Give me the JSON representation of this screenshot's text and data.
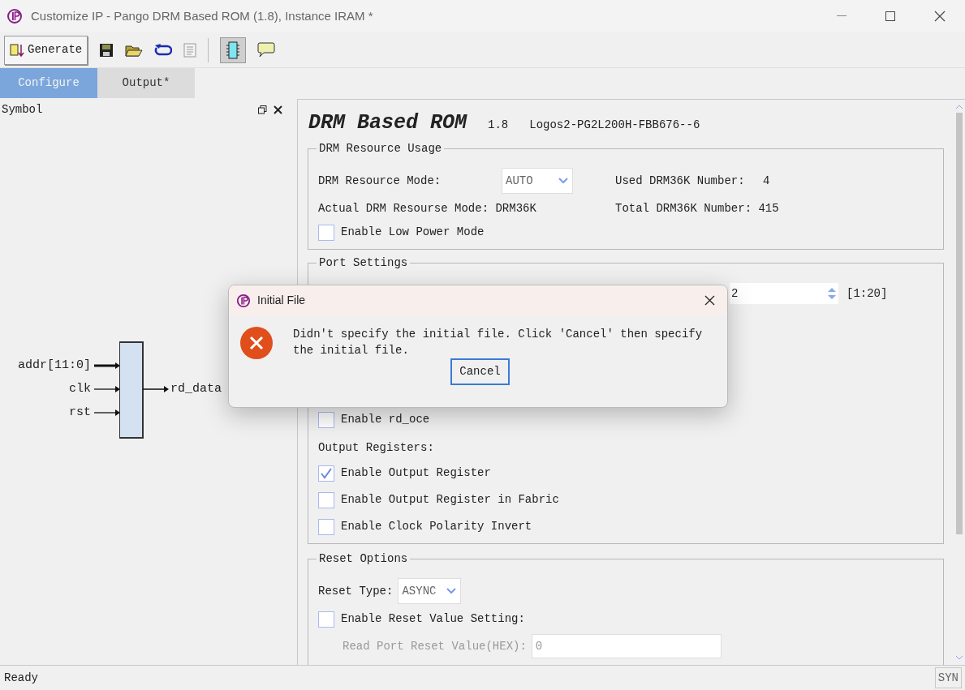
{
  "window": {
    "title": "Customize IP - Pango DRM Based ROM (1.8), Instance IRAM *"
  },
  "toolbar": {
    "generate_label": "Generate"
  },
  "tabs": [
    {
      "label": "Configure",
      "selected": true
    },
    {
      "label": "Output*",
      "selected": false
    }
  ],
  "symbol_panel": {
    "title": "Symbol",
    "inputs": [
      {
        "label": "addr[11:0]",
        "bus": true
      },
      {
        "label": "clk",
        "bus": false
      },
      {
        "label": "rst",
        "bus": false
      }
    ],
    "output": "rd_data"
  },
  "header": {
    "title": "DRM Based ROM",
    "version": "1.8",
    "device": "Logos2-PG2L200H-FBB676--6"
  },
  "resource_usage": {
    "title": "DRM Resource Usage",
    "mode_label": "DRM Resource Mode:",
    "mode_value": "AUTO",
    "used_label": "Used DRM36K Number:",
    "used_value": "4",
    "actual_label": "Actual DRM Resourse Mode: DRM36K",
    "total_label": "Total DRM36K Number: 415",
    "low_power": {
      "label": "Enable Low Power Mode",
      "checked": false
    }
  },
  "port_settings": {
    "title": "Port Settings",
    "spin_value": "2",
    "range": "[1:20]",
    "rd_oce": {
      "label": "Enable rd_oce",
      "checked": false
    },
    "output_registers_label": "Output Registers:",
    "options": [
      {
        "label": "Enable Output Register",
        "checked": true
      },
      {
        "label": "Enable Output Register in Fabric",
        "checked": false
      },
      {
        "label": "Enable Clock Polarity Invert",
        "checked": false
      }
    ]
  },
  "reset_options": {
    "title": "Reset Options",
    "type_label": "Reset Type:",
    "type_value": "ASYNC",
    "reset_value_setting": {
      "label": "Enable Reset Value Setting:",
      "checked": false
    },
    "reset_value_label": "Read Port Reset Value(HEX):",
    "reset_value": "0",
    "reset_value_disabled": true
  },
  "status_bar": {
    "text": "Ready",
    "indicator": "SYN"
  },
  "dialog": {
    "title": "Initial File",
    "message": "Didn't specify the initial file. Click 'Cancel' then specify the initial file.",
    "button": "Cancel"
  }
}
